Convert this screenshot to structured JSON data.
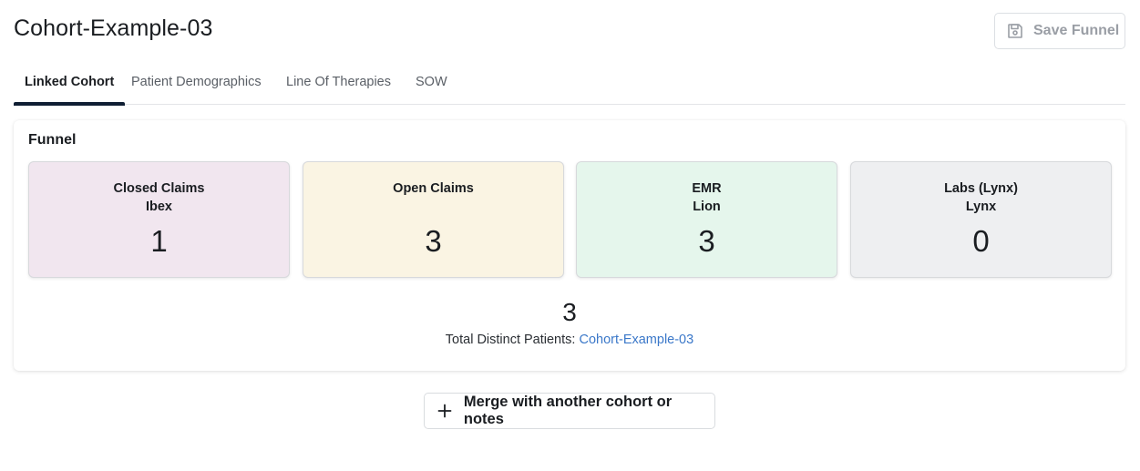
{
  "header": {
    "title": "Cohort-Example-03",
    "save_label": "Save Funnel",
    "save_icon": "floppy-disk-icon"
  },
  "tabs": [
    {
      "label": "Linked Cohort",
      "active": true
    },
    {
      "label": "Patient Demographics",
      "active": false
    },
    {
      "label": "Line Of Therapies",
      "active": false
    },
    {
      "label": "SOW",
      "active": false
    }
  ],
  "funnel": {
    "title": "Funnel",
    "sources": [
      {
        "name": "Closed Claims",
        "sub": "Ibex",
        "count": "1",
        "color": "#f1e6ef"
      },
      {
        "name": "Open Claims",
        "sub": "",
        "count": "3",
        "color": "#faf4e3"
      },
      {
        "name": "EMR",
        "sub": "Lion",
        "count": "3",
        "color": "#e5f6ec"
      },
      {
        "name": "Labs (Lynx)",
        "sub": "Lynx",
        "count": "0",
        "color": "#eeeff1"
      }
    ],
    "total_count": "3",
    "total_label": "Total Distinct Patients:",
    "total_link": "Cohort-Example-03"
  },
  "merge": {
    "label": "Merge with another cohort or notes",
    "icon": "plus-icon"
  }
}
